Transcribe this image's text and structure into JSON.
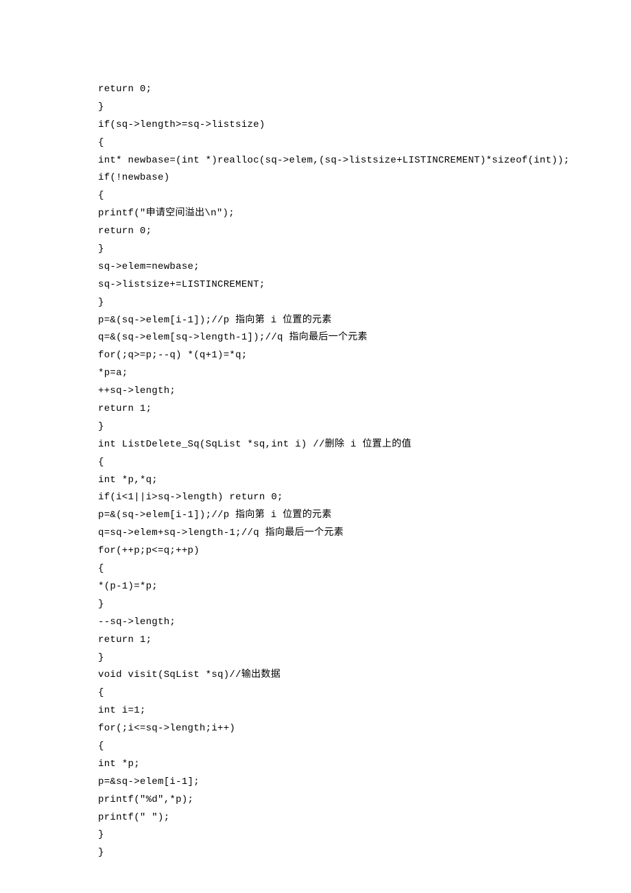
{
  "code_lines": [
    "return 0;",
    "}",
    "if(sq->length>=sq->listsize)",
    "{",
    "int* newbase=(int *)realloc(sq->elem,(sq->listsize+LISTINCREMENT)*sizeof(int));",
    "if(!newbase)",
    "{",
    "printf(\"申请空间溢出\\n\");",
    "return 0;",
    "}",
    "sq->elem=newbase;",
    "sq->listsize+=LISTINCREMENT;",
    "}",
    "p=&(sq->elem[i-1]);//p 指向第 i 位置的元素",
    "q=&(sq->elem[sq->length-1]);//q 指向最后一个元素",
    "for(;q>=p;--q) *(q+1)=*q;",
    "*p=a;",
    "++sq->length;",
    "return 1;",
    "}",
    "int ListDelete_Sq(SqList *sq,int i) //删除 i 位置上的值",
    "{",
    "int *p,*q;",
    "if(i<1||i>sq->length) return 0;",
    "p=&(sq->elem[i-1]);//p 指向第 i 位置的元素",
    "q=sq->elem+sq->length-1;//q 指向最后一个元素",
    "for(++p;p<=q;++p)",
    "{",
    "*(p-1)=*p;",
    "}",
    "--sq->length;",
    "return 1;",
    "}",
    "void visit(SqList *sq)//输出数据",
    "{",
    "int i=1;",
    "for(;i<=sq->length;i++)",
    "{",
    "int *p;",
    "p=&sq->elem[i-1];",
    "printf(\"%d\",*p);",
    "printf(\" \");",
    "}",
    "}"
  ]
}
